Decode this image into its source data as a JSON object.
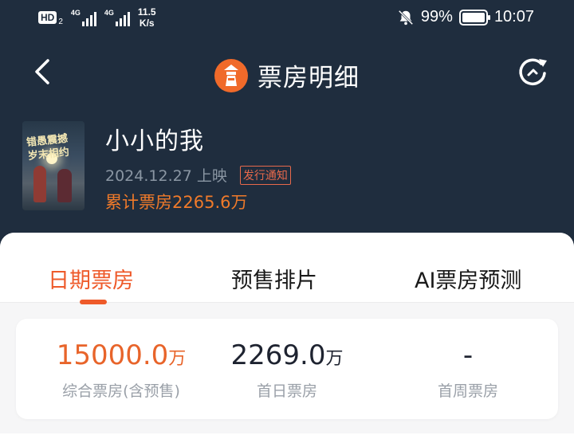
{
  "status_bar": {
    "hd_label": "HD",
    "hd_sub": "2",
    "sim1_label": "4G",
    "sim2_label": "4G",
    "speed_value": "11.5",
    "speed_unit": "K/s",
    "battery": "99%",
    "time": "10:07"
  },
  "nav": {
    "title": "票房明细",
    "icons": [
      "back-arrow-icon",
      "lighthouse-logo-icon",
      "refresh-icon"
    ]
  },
  "movie": {
    "poster_text": "错愚震撼 岁末相约",
    "title": "小小的我",
    "release": "2024.12.27 上映",
    "notice": "发行通知",
    "total_box_office": "累计票房2265.6万"
  },
  "tabs": [
    {
      "label": "日期票房",
      "active": true
    },
    {
      "label": "预售排片",
      "active": false
    },
    {
      "label": "AI票房预测",
      "active": false
    }
  ],
  "stats": [
    {
      "value": "15000.0",
      "unit": "万",
      "label": "综合票房(含预售)",
      "highlight": true
    },
    {
      "value": "2269.0",
      "unit": "万",
      "label": "首日票房",
      "highlight": false
    },
    {
      "value": "-",
      "unit": "",
      "label": "首周票房",
      "highlight": false
    }
  ],
  "colors": {
    "header_bg": "#1f2d3e",
    "accent": "#ee5a2a",
    "total_text": "#f07a2a"
  }
}
